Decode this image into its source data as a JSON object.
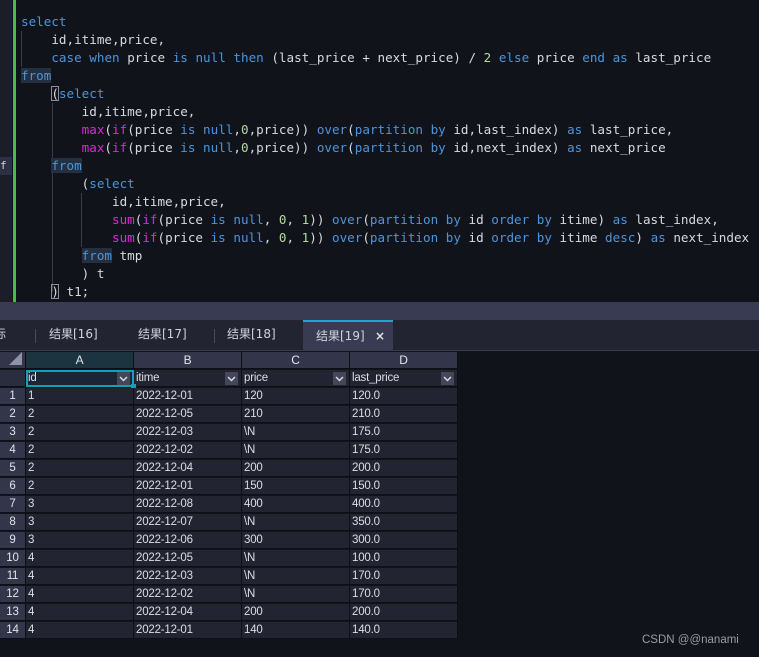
{
  "editor": {
    "gutter_marker": "f",
    "lines": [
      [
        {
          "t": "select",
          "c": "kw"
        }
      ],
      [
        {
          "t": "    id,itime,price,"
        }
      ],
      [
        {
          "t": "    "
        },
        {
          "t": "case",
          "c": "kw"
        },
        {
          "t": " "
        },
        {
          "t": "when",
          "c": "kw"
        },
        {
          "t": " price "
        },
        {
          "t": "is",
          "c": "kw"
        },
        {
          "t": " "
        },
        {
          "t": "null",
          "c": "kw"
        },
        {
          "t": " "
        },
        {
          "t": "then",
          "c": "kw"
        },
        {
          "t": " (last_price + next_price) / "
        },
        {
          "t": "2",
          "c": "num"
        },
        {
          "t": " "
        },
        {
          "t": "else",
          "c": "kw"
        },
        {
          "t": " price "
        },
        {
          "t": "end",
          "c": "kw"
        },
        {
          "t": " "
        },
        {
          "t": "as",
          "c": "kw"
        },
        {
          "t": " last_price"
        }
      ],
      [
        {
          "t": "from",
          "c": "kw hl"
        }
      ],
      [
        {
          "t": "    "
        },
        {
          "t": "(",
          "c": "brk"
        },
        {
          "t": "select",
          "c": "kw"
        }
      ],
      [
        {
          "t": "        id,itime,price,"
        }
      ],
      [
        {
          "t": "        "
        },
        {
          "t": "max",
          "c": "fn"
        },
        {
          "t": "("
        },
        {
          "t": "if",
          "c": "fn"
        },
        {
          "t": "(price "
        },
        {
          "t": "is",
          "c": "kw"
        },
        {
          "t": " "
        },
        {
          "t": "null",
          "c": "kw"
        },
        {
          "t": ","
        },
        {
          "t": "0",
          "c": "num"
        },
        {
          "t": ",price)) "
        },
        {
          "t": "over",
          "c": "kw"
        },
        {
          "t": "("
        },
        {
          "t": "partition",
          "c": "kw"
        },
        {
          "t": " "
        },
        {
          "t": "by",
          "c": "kw"
        },
        {
          "t": " id,last_index) "
        },
        {
          "t": "as",
          "c": "kw"
        },
        {
          "t": " last_price,"
        }
      ],
      [
        {
          "t": "        "
        },
        {
          "t": "max",
          "c": "fn"
        },
        {
          "t": "("
        },
        {
          "t": "if",
          "c": "fn"
        },
        {
          "t": "(price "
        },
        {
          "t": "is",
          "c": "kw"
        },
        {
          "t": " "
        },
        {
          "t": "null",
          "c": "kw"
        },
        {
          "t": ","
        },
        {
          "t": "0",
          "c": "num"
        },
        {
          "t": ",price)) "
        },
        {
          "t": "over",
          "c": "kw"
        },
        {
          "t": "("
        },
        {
          "t": "partition",
          "c": "kw"
        },
        {
          "t": " "
        },
        {
          "t": "by",
          "c": "kw"
        },
        {
          "t": " id,next_index) "
        },
        {
          "t": "as",
          "c": "kw"
        },
        {
          "t": " next_price"
        }
      ],
      [
        {
          "t": "    "
        },
        {
          "t": "from",
          "c": "kw hl"
        }
      ],
      [
        {
          "t": "        ("
        },
        {
          "t": "select",
          "c": "kw"
        }
      ],
      [
        {
          "t": "            id,itime,price,"
        }
      ],
      [
        {
          "t": "            "
        },
        {
          "t": "sum",
          "c": "fn"
        },
        {
          "t": "("
        },
        {
          "t": "if",
          "c": "fn"
        },
        {
          "t": "(price "
        },
        {
          "t": "is",
          "c": "kw"
        },
        {
          "t": " "
        },
        {
          "t": "null",
          "c": "kw"
        },
        {
          "t": ", "
        },
        {
          "t": "0",
          "c": "num"
        },
        {
          "t": ", "
        },
        {
          "t": "1",
          "c": "num"
        },
        {
          "t": ")) "
        },
        {
          "t": "over",
          "c": "kw"
        },
        {
          "t": "("
        },
        {
          "t": "partition",
          "c": "kw"
        },
        {
          "t": " "
        },
        {
          "t": "by",
          "c": "kw"
        },
        {
          "t": " id "
        },
        {
          "t": "order",
          "c": "kw"
        },
        {
          "t": " "
        },
        {
          "t": "by",
          "c": "kw"
        },
        {
          "t": " itime) "
        },
        {
          "t": "as",
          "c": "kw"
        },
        {
          "t": " last_index,"
        }
      ],
      [
        {
          "t": "            "
        },
        {
          "t": "sum",
          "c": "fn"
        },
        {
          "t": "("
        },
        {
          "t": "if",
          "c": "fn"
        },
        {
          "t": "(price "
        },
        {
          "t": "is",
          "c": "kw"
        },
        {
          "t": " "
        },
        {
          "t": "null",
          "c": "kw"
        },
        {
          "t": ", "
        },
        {
          "t": "0",
          "c": "num"
        },
        {
          "t": ", "
        },
        {
          "t": "1",
          "c": "num"
        },
        {
          "t": ")) "
        },
        {
          "t": "over",
          "c": "kw"
        },
        {
          "t": "("
        },
        {
          "t": "partition",
          "c": "kw"
        },
        {
          "t": " "
        },
        {
          "t": "by",
          "c": "kw"
        },
        {
          "t": " id "
        },
        {
          "t": "order",
          "c": "kw"
        },
        {
          "t": " "
        },
        {
          "t": "by",
          "c": "kw"
        },
        {
          "t": " itime "
        },
        {
          "t": "desc",
          "c": "kw"
        },
        {
          "t": ") "
        },
        {
          "t": "as",
          "c": "kw"
        },
        {
          "t": " next_index"
        }
      ],
      [
        {
          "t": "        "
        },
        {
          "t": "from",
          "c": "kw hl"
        },
        {
          "t": " tmp"
        }
      ],
      [
        {
          "t": "        ) t"
        }
      ],
      [
        {
          "t": "    "
        },
        {
          "t": ")",
          "c": "brk"
        },
        {
          "t": " t1;"
        }
      ]
    ]
  },
  "tabs": {
    "items": [
      {
        "label": "标"
      },
      {
        "label": "结果[16]"
      },
      {
        "label": "结果[17]"
      },
      {
        "label": "结果[18]"
      },
      {
        "label": "结果[19]",
        "active": true
      }
    ],
    "close_label": "×"
  },
  "grid": {
    "column_letters": [
      "A",
      "B",
      "C",
      "D"
    ],
    "field_headers": [
      "id",
      "itime",
      "price",
      "last_price"
    ],
    "dropdown_glyph": "⌄",
    "rows": [
      {
        "n": "1",
        "id": "1",
        "itime": "2022-12-01",
        "price": "120",
        "last_price": "120.0"
      },
      {
        "n": "2",
        "id": "2",
        "itime": "2022-12-05",
        "price": "210",
        "last_price": "210.0"
      },
      {
        "n": "3",
        "id": "2",
        "itime": "2022-12-03",
        "price": "\\N",
        "last_price": "175.0"
      },
      {
        "n": "4",
        "id": "2",
        "itime": "2022-12-02",
        "price": "\\N",
        "last_price": "175.0"
      },
      {
        "n": "5",
        "id": "2",
        "itime": "2022-12-04",
        "price": "200",
        "last_price": "200.0"
      },
      {
        "n": "6",
        "id": "2",
        "itime": "2022-12-01",
        "price": "150",
        "last_price": "150.0"
      },
      {
        "n": "7",
        "id": "3",
        "itime": "2022-12-08",
        "price": "400",
        "last_price": "400.0"
      },
      {
        "n": "8",
        "id": "3",
        "itime": "2022-12-07",
        "price": "\\N",
        "last_price": "350.0"
      },
      {
        "n": "9",
        "id": "3",
        "itime": "2022-12-06",
        "price": "300",
        "last_price": "300.0"
      },
      {
        "n": "10",
        "id": "4",
        "itime": "2022-12-05",
        "price": "\\N",
        "last_price": "100.0"
      },
      {
        "n": "11",
        "id": "4",
        "itime": "2022-12-03",
        "price": "\\N",
        "last_price": "170.0"
      },
      {
        "n": "12",
        "id": "4",
        "itime": "2022-12-02",
        "price": "\\N",
        "last_price": "170.0"
      },
      {
        "n": "13",
        "id": "4",
        "itime": "2022-12-04",
        "price": "200",
        "last_price": "200.0"
      },
      {
        "n": "14",
        "id": "4",
        "itime": "2022-12-01",
        "price": "140",
        "last_price": "140.0"
      }
    ]
  },
  "watermark": "CSDN @@nanami"
}
